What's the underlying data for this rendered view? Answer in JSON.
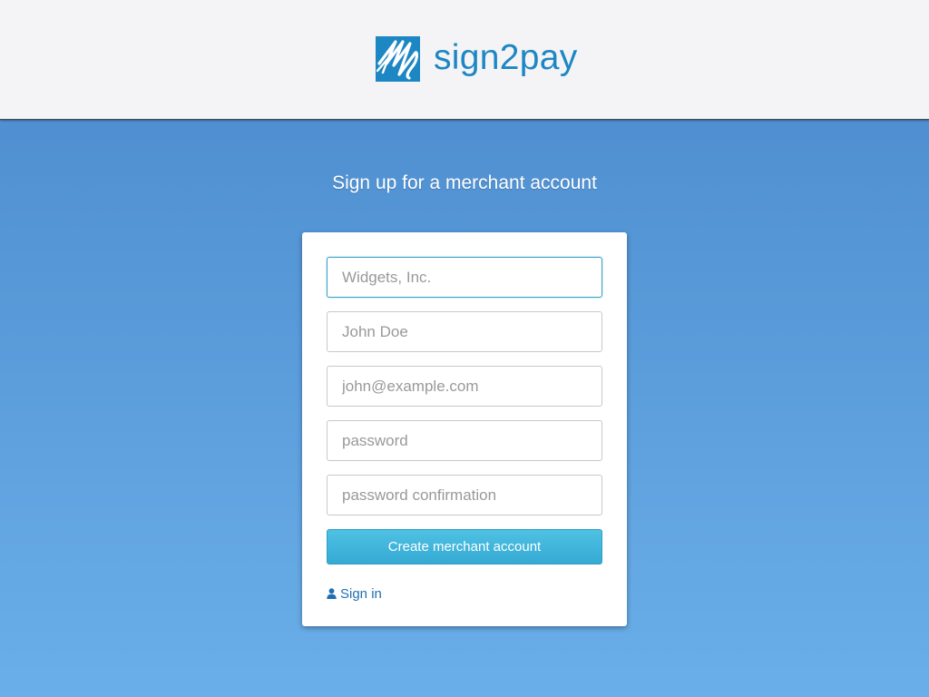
{
  "brand": {
    "name_part1": "sign",
    "name_part2": "2",
    "name_part3": "pay",
    "logo_icon": "signature-mark-icon",
    "color": "#1d87c3"
  },
  "page": {
    "heading": "Sign up for a merchant account"
  },
  "form": {
    "company_placeholder": "Widgets, Inc.",
    "name_placeholder": "John Doe",
    "email_placeholder": "john@example.com",
    "password_placeholder": "password",
    "password_confirmation_placeholder": "password confirmation",
    "submit_label": "Create merchant account",
    "signin_label": "Sign in",
    "signin_icon": "user-icon"
  },
  "colors": {
    "background_top": "#4a89cc",
    "background_bottom": "#6aafe9",
    "button": "#3cb2da",
    "link": "#1f6fb5"
  }
}
